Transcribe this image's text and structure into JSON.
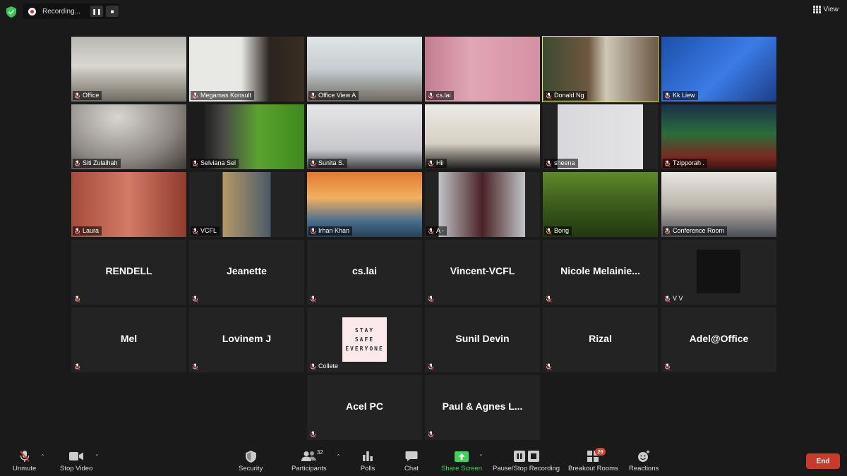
{
  "topbar": {
    "recording_label": "Recording...",
    "pause_glyph": "❚❚",
    "stop_glyph": "■",
    "view_label": "View"
  },
  "tiles": [
    {
      "name": "Office",
      "kind": "video"
    },
    {
      "name": "Megamas Konsult",
      "kind": "video"
    },
    {
      "name": "Office View A",
      "kind": "video"
    },
    {
      "name": "cs.lai",
      "kind": "video"
    },
    {
      "name": "Donald Ng",
      "kind": "video",
      "active": true
    },
    {
      "name": "Kk Liew",
      "kind": "video"
    },
    {
      "name": "Siti Zulaihah",
      "kind": "video"
    },
    {
      "name": "Selviana Sel",
      "kind": "video"
    },
    {
      "name": "Sunita S.",
      "kind": "video"
    },
    {
      "name": "Hii",
      "kind": "video"
    },
    {
      "name": "sheena",
      "kind": "video"
    },
    {
      "name": "Tzipporah .",
      "kind": "video"
    },
    {
      "name": "Laura",
      "kind": "video"
    },
    {
      "name": "VCFL",
      "kind": "video"
    },
    {
      "name": "Irhan Khan",
      "kind": "video"
    },
    {
      "name": "A -",
      "kind": "video"
    },
    {
      "name": "Bong",
      "kind": "video"
    },
    {
      "name": "Conference Room",
      "kind": "video"
    },
    {
      "name": "RENDELL",
      "kind": "name"
    },
    {
      "name": "Jeanette",
      "kind": "name"
    },
    {
      "name": "cs.lai",
      "kind": "name"
    },
    {
      "name": "Vincent-VCFL",
      "kind": "name"
    },
    {
      "name": "Nicole  Melainie...",
      "kind": "name"
    },
    {
      "name": "V V",
      "kind": "avatar"
    },
    {
      "name": "Mel",
      "kind": "name"
    },
    {
      "name": "Lovinem J",
      "kind": "name"
    },
    {
      "name": "Collete",
      "kind": "card"
    },
    {
      "name": "Sunil Devin",
      "kind": "name"
    },
    {
      "name": "Rizal",
      "kind": "name"
    },
    {
      "name": "Adel@Office",
      "kind": "name"
    },
    {
      "name": "Acel PC",
      "kind": "name"
    },
    {
      "name": "Paul & Agnes L...",
      "kind": "name"
    }
  ],
  "stay_card": {
    "line1": "STAY",
    "line2": "SAFE",
    "line3": "EVERYONE"
  },
  "toolbar": {
    "unmute": "Unmute",
    "stop_video": "Stop Video",
    "security": "Security",
    "participants": "Participants",
    "participants_count": "32",
    "polls": "Polls",
    "chat": "Chat",
    "share_screen": "Share Screen",
    "pause_stop_recording": "Pause/Stop Recording",
    "breakout_rooms": "Breakout Rooms",
    "breakout_badge": "29",
    "reactions": "Reactions",
    "end": "End"
  },
  "colors": {
    "background": "#1a1a1a",
    "tile": "#232323",
    "active_speaker": "#e2e46a",
    "share_green": "#3fd35a",
    "end_red": "#c83a2c",
    "mic_off_red": "#e0392f"
  }
}
